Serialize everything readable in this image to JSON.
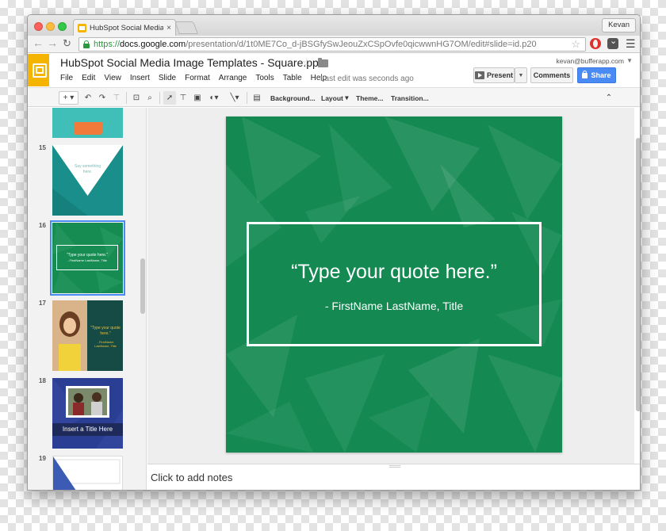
{
  "browser": {
    "tab_title": "HubSpot Social Media Image",
    "tab_close": "×",
    "user": "Kevan",
    "url": {
      "scheme": "https://",
      "host": "docs.google.com",
      "path": "/presentation/d/1t0ME7Co_d-jBSGfySwJeouZxCSpOvfe0qicwwnHG7OM/edit#slide=id.p20"
    }
  },
  "doc": {
    "title": "HubSpot Social Media Image Templates - Square.pptx",
    "menu": [
      "File",
      "Edit",
      "View",
      "Insert",
      "Slide",
      "Format",
      "Arrange",
      "Tools",
      "Table",
      "Help"
    ],
    "last_edit": "Last edit was seconds ago",
    "account": "kevan@bufferapp.com",
    "present_label": "Present",
    "comments_label": "Comments",
    "share_label": "Share"
  },
  "toolbar": {
    "background": "Background...",
    "layout": "Layout",
    "theme": "Theme...",
    "transition": "Transition..."
  },
  "filmstrip": {
    "slides": [
      {
        "number": "15",
        "text": "Say something here."
      },
      {
        "number": "16",
        "text": "\"Type your quote here.\"",
        "author": "- FirstName LastName, Title"
      },
      {
        "number": "17",
        "text": "\"Type your quote here.\"",
        "author": "- FirstName LastName, Title"
      },
      {
        "number": "18",
        "text": "Insert a Title Here"
      },
      {
        "number": "19",
        "text": ""
      }
    ],
    "selected": "16"
  },
  "slide": {
    "quote": "“Type your quote here.”",
    "author": "- FirstName LastName, Title"
  },
  "notes": {
    "placeholder": "Click to add notes"
  },
  "colors": {
    "slide_green": "#148a52",
    "share_blue": "#4a8af4",
    "slides_yellow": "#f4b400"
  }
}
